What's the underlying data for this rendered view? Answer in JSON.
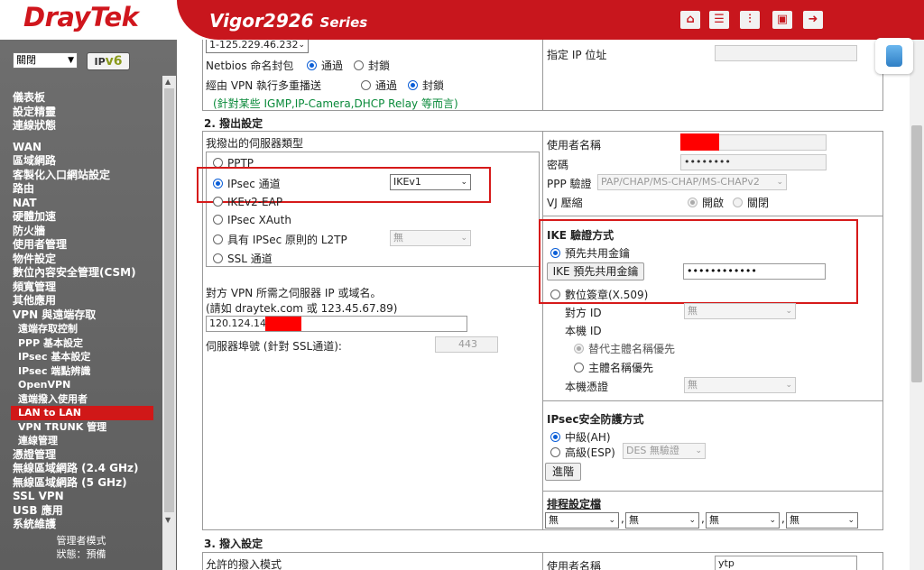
{
  "header": {
    "logo": "DrayTek",
    "model": "Vigor2926",
    "series": "Series",
    "icons": [
      "home-icon",
      "list-icon",
      "sliders-icon",
      "save-icon",
      "logout-icon"
    ]
  },
  "sidebar": {
    "language": "關閉",
    "ipv6_label": "IP",
    "ipv6_suffix": "v6",
    "items": [
      {
        "label": "儀表板"
      },
      {
        "label": "設定精靈"
      },
      {
        "label": "連線狀態"
      },
      {
        "label": "WAN"
      },
      {
        "label": "區域網路"
      },
      {
        "label": "客製化入口網站設定"
      },
      {
        "label": "路由"
      },
      {
        "label": "NAT"
      },
      {
        "label": "硬體加速"
      },
      {
        "label": "防火牆"
      },
      {
        "label": "使用者管理"
      },
      {
        "label": "物件設定"
      },
      {
        "label": "數位內容安全管理(CSM)"
      },
      {
        "label": "頻寬管理"
      },
      {
        "label": "其他應用"
      },
      {
        "label": "VPN 與遠端存取"
      },
      {
        "label": "遠端存取控制"
      },
      {
        "label": "PPP 基本設定"
      },
      {
        "label": "IPsec 基本設定"
      },
      {
        "label": "IPsec 端點辨識"
      },
      {
        "label": "OpenVPN"
      },
      {
        "label": "遠端撥入使用者"
      },
      {
        "label": "LAN to LAN"
      },
      {
        "label": "VPN TRUNK 管理"
      },
      {
        "label": "連線管理"
      },
      {
        "label": "憑證管理"
      },
      {
        "label": "無線區域網路 (2.4 GHz)"
      },
      {
        "label": "無線區域網路 (5 GHz)"
      },
      {
        "label": "SSL VPN"
      },
      {
        "label": "USB 應用"
      },
      {
        "label": "系統維護"
      }
    ],
    "footer_mode": "管理者模式",
    "footer_status": "狀態：預備"
  },
  "top": {
    "ip_select": "1-125.229.46.232",
    "netbios_label": "Netbios 命名封包",
    "pass": "通過",
    "block": "封鎖",
    "multicast_label": "經由 VPN 執行多重播送",
    "multicast_note": "(針對某些 IGMP,IP-Camera,DHCP Relay 等而言)",
    "specify_ip_label": "指定 IP 位址"
  },
  "dialout": {
    "section_title": "2. 撥出設定",
    "server_type_title": "我撥出的伺服器類型",
    "pptp": "PPTP",
    "ipsec": "IPsec 通道",
    "ike_select": "IKEv1",
    "ikev2": "IKEv2-EAP",
    "xauth": "IPsec XAuth",
    "l2tp": "具有 IPSec 原則的 L2TP",
    "l2tp_select": "無",
    "ssl": "SSL 通道",
    "server_host_label": "對方 VPN 所需之伺服器 IP 或域名。",
    "server_host_example": "(請如 draytek.com 或 123.45.67.89)",
    "server_host_value": "120.124.145",
    "server_port_label": "伺服器埠號 (針對 SSL通道):",
    "server_port_value": "443",
    "username_label": "使用者名稱",
    "password_label": "密碼",
    "password_value": "••••••••",
    "ppp_auth_label": "PPP 驗證",
    "ppp_auth_value": "PAP/CHAP/MS-CHAP/MS-CHAPv2",
    "vj_label": "VJ 壓縮",
    "on": "開啟",
    "off": "關閉",
    "ike_auth_title": "IKE 驗證方式",
    "psk": "預先共用金鑰",
    "psk_button": "IKE 預先共用金鑰",
    "psk_value": "••••••••••••",
    "cert": "數位簽章(X.509)",
    "peer_id_label": "對方 ID",
    "peer_id_value": "無",
    "local_id_label": "本機 ID",
    "alt_subject": "替代主體名稱優先",
    "subject": "主體名稱優先",
    "local_cert_label": "本機憑證",
    "local_cert_value": "無",
    "ipsec_sec_title": "IPsec安全防護方式",
    "ah": "中級(AH)",
    "esp": "高級(ESP)",
    "esp_select": "DES 無驗證",
    "advanced_button": "進階",
    "schedule_title": "排程設定檔",
    "schedule_values": [
      "無",
      "無",
      "無",
      "無"
    ]
  },
  "dialin": {
    "section_title": "3. 撥入設定",
    "allowed_mode": "允許的撥入模式",
    "username_label": "使用者名稱",
    "username_value": "ytp"
  },
  "colors": {
    "brand_red": "#c8161d",
    "sidebar_gray": "#666666",
    "highlight_red": "#d61a1a",
    "note_green": "#0a8a3a"
  }
}
